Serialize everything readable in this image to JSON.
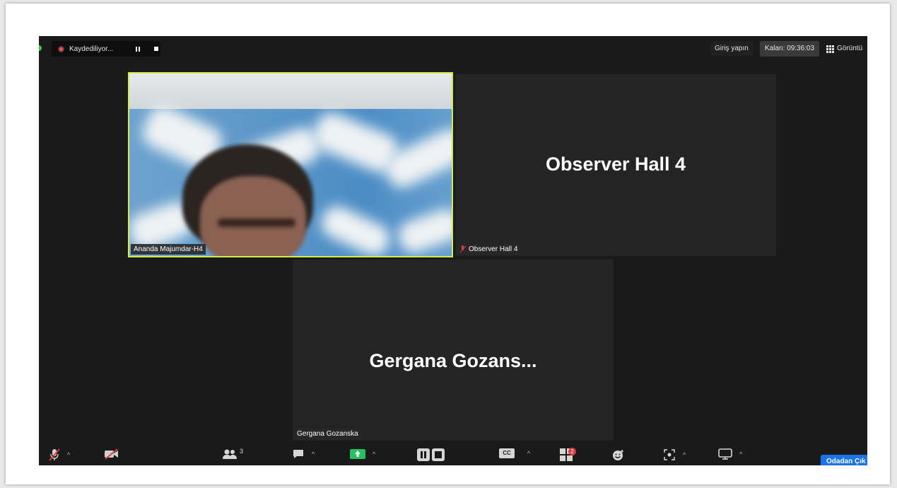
{
  "topbar": {
    "recording_label": "Kaydediliyor...",
    "sign_in": "Giriş yapın",
    "time_left": "Kalan: 09:36:03",
    "view_label": "Görüntü"
  },
  "tiles": {
    "video_participant": "Ananda Majumdar-H4",
    "observer_big": "Observer Hall 4",
    "observer_tag": "Observer Hall 4",
    "gergana_big": "Gergana  Gozans...",
    "gergana_tag": "Gergana Gozanska"
  },
  "toolbar": {
    "participants_count": "3",
    "breakout_badge": "2",
    "leave_label": "Odadan Çık",
    "captions_label": "CC"
  },
  "colors": {
    "background": "#1a1a1a",
    "tile": "#242424",
    "active_speaker": "#d2ec48",
    "share_green": "#24c160",
    "leave_blue": "#1a73e8",
    "alert_red": "#e0393e"
  }
}
